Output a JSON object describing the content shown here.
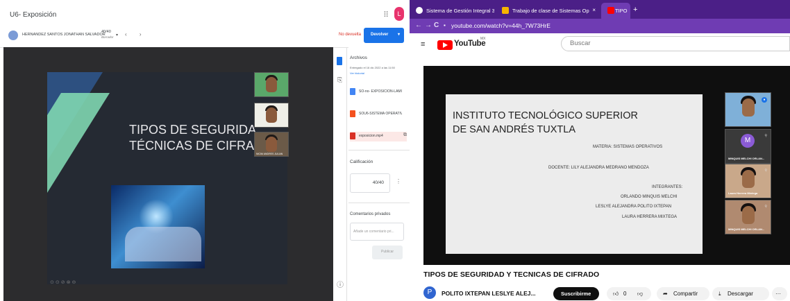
{
  "classroom": {
    "title": "U6- Exposición",
    "apps_icon": "apps-grid-icon",
    "account_initial": "L",
    "student": {
      "name": "HERNANDEZ SANTOS JONATHAN SALVADOR",
      "grade": "40/40",
      "grade_status": "Borrador"
    },
    "nav_arrows": "‹ ›",
    "not_returned": "No devuelta",
    "return_button": "Devolver",
    "slide": {
      "title_line1": "TIPOS DE SEGURIDA",
      "title_line2": "TÉCNICAS DE CIFRA"
    },
    "cam_name": "NICIM ANDRES JULIAN",
    "viewer_controls": "⊙⊙⊘⊗⊖",
    "files_header": "Archivos",
    "submitted": "Entregado el 16 dic 2022 a las 11:50",
    "history_link": "Ver historial",
    "files": [
      {
        "name": "SO-no- EXPOSICION-LAMINA",
        "color": "#4285f4"
      },
      {
        "name": "SOU6-SISTEMA OPERATIVO",
        "color": "#f4511e"
      },
      {
        "name": "exposicion.mp4",
        "color": "#d93025"
      }
    ],
    "grade_header": "Calificación",
    "grade_value": "40/40",
    "comments_header": "Comentarios privados",
    "comment_placeholder": "Añade un comentario pri...",
    "publish_button": "Publicar"
  },
  "browser": {
    "tabs": [
      {
        "title": "Sistema de Gestión Integral 3",
        "icon_color": "#ffffff"
      },
      {
        "title": "Trabajo de clase de Sistemas Op",
        "icon_color": "#f6b400"
      },
      {
        "title": "TIPOS DE SEGURIDAD Y TÉC",
        "icon_color": "#ff0000"
      }
    ],
    "url": "youtube.com/watch?v=44h_7W73HrE",
    "youtube": {
      "logo_text": "YouTube",
      "region": "MX",
      "search_placeholder": "Buscar"
    },
    "video_slide": {
      "heading_line1": "INSTITUTO TECNOLÓGICO SUPERIOR",
      "heading_line2": "DE SAN ANDRÉS TUXTLA",
      "materia": "MATERIA: SISTEMAS OPERATIVOS",
      "docente": "DOCENTE: LILY ALEJANDRA MEDRANO MENDOZA",
      "integrantes_label": "INTEGRANTES:",
      "members": [
        "ORLANDO MINQUIS MELCHI",
        "LESLYE ALEJANDRA POLITO IXTEPAN",
        "LAURA HERRERA MIXTEGA"
      ]
    },
    "participants": [
      {
        "name": ""
      },
      {
        "name": "MINQUIS MELCHI ORLAN...",
        "initial": "M"
      },
      {
        "name": "Laura Herrera Mixtega"
      },
      {
        "name": "MINQUIS MELCHI ORLAN..."
      }
    ],
    "video_title": "TIPOS DE SEGURIDAD Y TECNICAS DE CIFRADO",
    "channel_initial": "P",
    "channel_name": "POLITO IXTEPAN LESLYE ALEJ...",
    "subscribe_button": "Suscribirme",
    "likes": "0",
    "share_button": "Compartir",
    "download_button": "Descargar",
    "more": "···"
  }
}
